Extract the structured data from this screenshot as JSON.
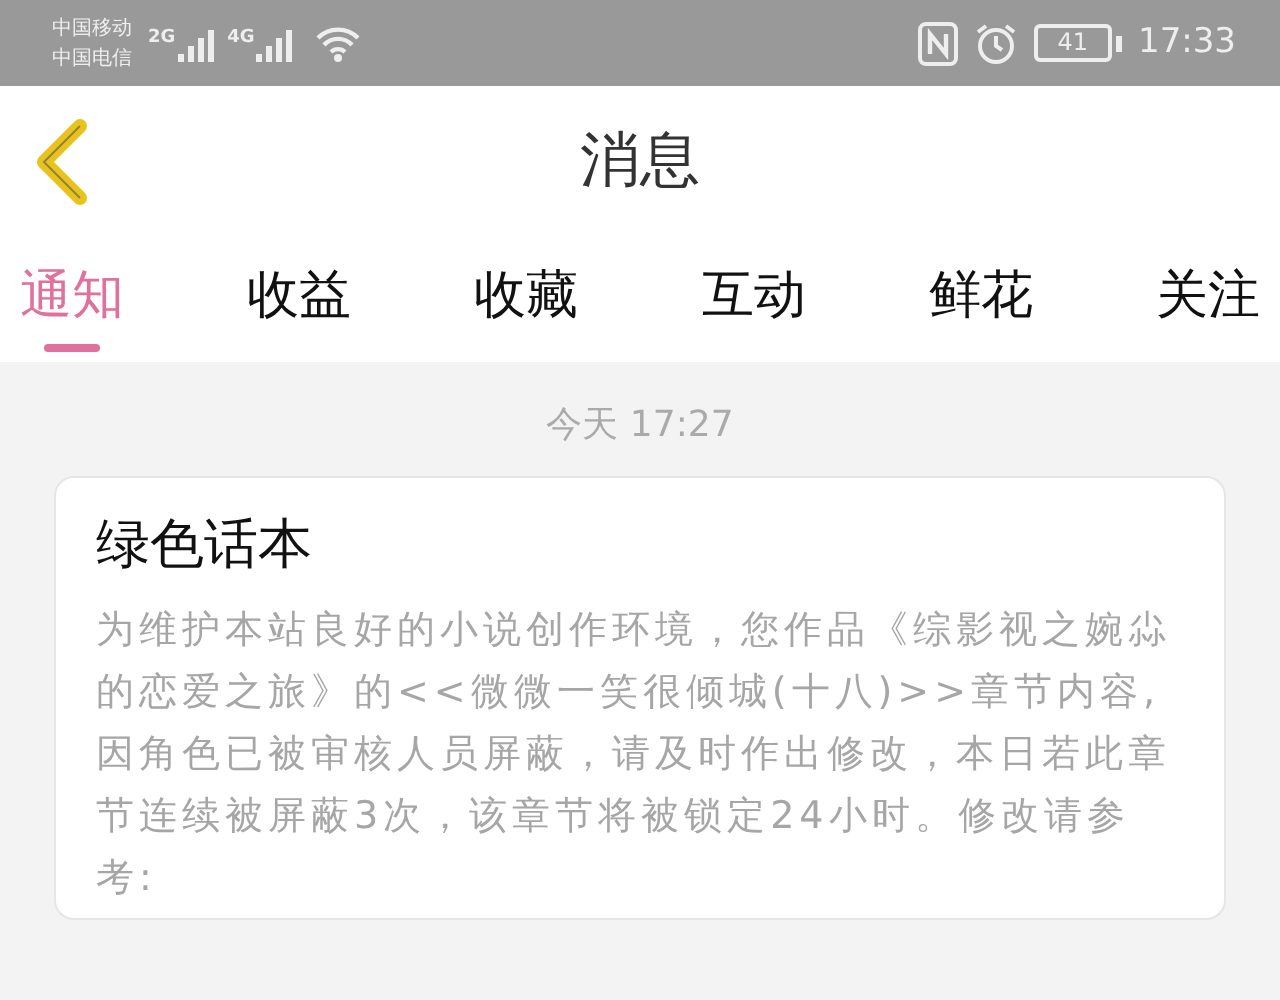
{
  "status_bar": {
    "carriers": [
      "中国移动",
      "中国电信"
    ],
    "networks": [
      "2G",
      "4G"
    ],
    "battery": "41",
    "time": "17:33"
  },
  "header": {
    "title": "消息"
  },
  "tabs": [
    {
      "label": "通知",
      "selected": true
    },
    {
      "label": "收益",
      "selected": false
    },
    {
      "label": "收藏",
      "selected": false
    },
    {
      "label": "互动",
      "selected": false
    },
    {
      "label": "鲜花",
      "selected": false
    },
    {
      "label": "关注",
      "selected": false
    }
  ],
  "messages": [
    {
      "time": "今天 17:27",
      "title": "绿色话本",
      "body": "为维护本站良好的小说创作环境，您作品《综影视之婉尛的恋爱之旅》的<<微微一笑很倾城(十八)>>章节内容,因角色已被审核人员屏蔽，请及时作出修改，本日若此章节连续被屏蔽3次，该章节将被锁定24小时。修改请参考:"
    }
  ]
}
